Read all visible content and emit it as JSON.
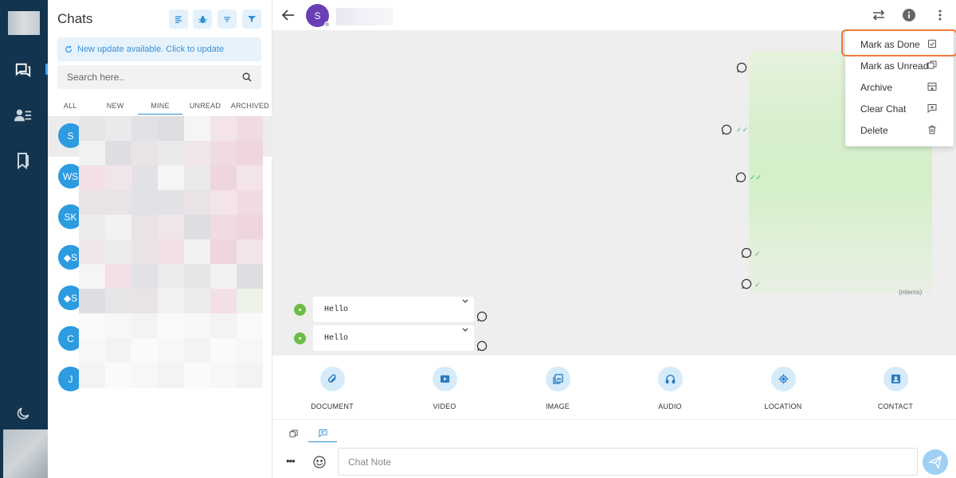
{
  "sidebar": {
    "icons": [
      "chat-icon",
      "contacts-icon",
      "bookmark-icon",
      "moon-icon"
    ]
  },
  "chat_list": {
    "title": "Chats",
    "header_buttons": [
      "sort-icon",
      "bug-icon",
      "filter-lines-icon",
      "funnel-icon"
    ],
    "update_banner": "New update available. Click to update",
    "search_placeholder": "Search here..",
    "tabs": [
      {
        "label": "ALL"
      },
      {
        "label": "NEW"
      },
      {
        "label": "MINE",
        "active": true
      },
      {
        "label": "UNREAD"
      },
      {
        "label": "ARCHIVED"
      }
    ],
    "chats": [
      {
        "initials": "S",
        "selected": true
      },
      {
        "initials": "WS"
      },
      {
        "initials": "SK"
      },
      {
        "initials": "◆S"
      },
      {
        "initials": "◆S"
      },
      {
        "initials": "C"
      },
      {
        "initials": "J"
      }
    ]
  },
  "conversation": {
    "contact_initial": "S",
    "header_icons": [
      "transfer-icon",
      "info-icon",
      "more-vertical-icon"
    ],
    "footer_note": "(interns)",
    "messages": [
      {
        "text": "Hello"
      },
      {
        "text": "Hello"
      }
    ]
  },
  "context_menu": {
    "items": [
      {
        "label": "Mark as Done",
        "icon": "check-square-icon",
        "highlighted": true
      },
      {
        "label": "Mark as Unread",
        "icon": "copy-icon"
      },
      {
        "label": "Archive",
        "icon": "archive-icon"
      },
      {
        "label": "Clear Chat",
        "icon": "message-x-icon"
      },
      {
        "label": "Delete",
        "icon": "trash-icon"
      }
    ]
  },
  "attachments": [
    {
      "label": "DOCUMENT",
      "icon": "paperclip-icon"
    },
    {
      "label": "VIDEO",
      "icon": "video-icon"
    },
    {
      "label": "IMAGE",
      "icon": "image-icon"
    },
    {
      "label": "AUDIO",
      "icon": "headphones-icon"
    },
    {
      "label": "LOCATION",
      "icon": "location-icon"
    },
    {
      "label": "CONTACT",
      "icon": "contact-card-icon"
    }
  ],
  "composer": {
    "tabs": [
      "copy-icon",
      "chat-note-icon"
    ],
    "note_placeholder": "Chat Note"
  },
  "colors": {
    "rail": "#13344f",
    "accent": "#2c9be0",
    "highlight": "#ec7a3b",
    "whatsapp": "#3fb96e"
  }
}
